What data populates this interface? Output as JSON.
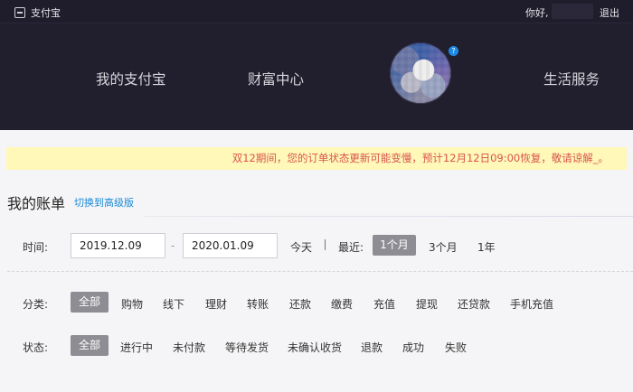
{
  "topbar": {
    "logo_text": "支付宝",
    "hello": "你好,",
    "logout": "退出"
  },
  "nav": {
    "items": [
      "我的支付宝",
      "财富中心",
      "生活服务"
    ],
    "badge": "?"
  },
  "notice": {
    "text": "双12期间，您的订单状态更新可能变慢，预计12月12日09:00恢复，敬请谅解_。"
  },
  "bill": {
    "title": "我的账单",
    "switch_link": "切换到高级版"
  },
  "time_filter": {
    "label": "时间:",
    "start_date": "2019.12.09",
    "separator": "-",
    "end_date": "2020.01.09",
    "today": "今天",
    "recent_label": "最近:",
    "ranges": [
      "1个月",
      "3个月",
      "1年"
    ],
    "selected_range": "1个月"
  },
  "category_filter": {
    "label": "分类:",
    "options": [
      "全部",
      "购物",
      "线下",
      "理财",
      "转账",
      "还款",
      "缴费",
      "充值",
      "提现",
      "还贷款",
      "手机充值"
    ],
    "selected": "全部"
  },
  "status_filter": {
    "label": "状态:",
    "options": [
      "全部",
      "进行中",
      "未付款",
      "等待发货",
      "未确认收货",
      "退款",
      "成功",
      "失败"
    ],
    "selected": "全部"
  },
  "colors": {
    "header_bg": "#211f2e",
    "notice_bg": "#fff8b8",
    "notice_text": "#d9534f",
    "link": "#1a8ad6",
    "pill_selected": "#8d8d93"
  }
}
